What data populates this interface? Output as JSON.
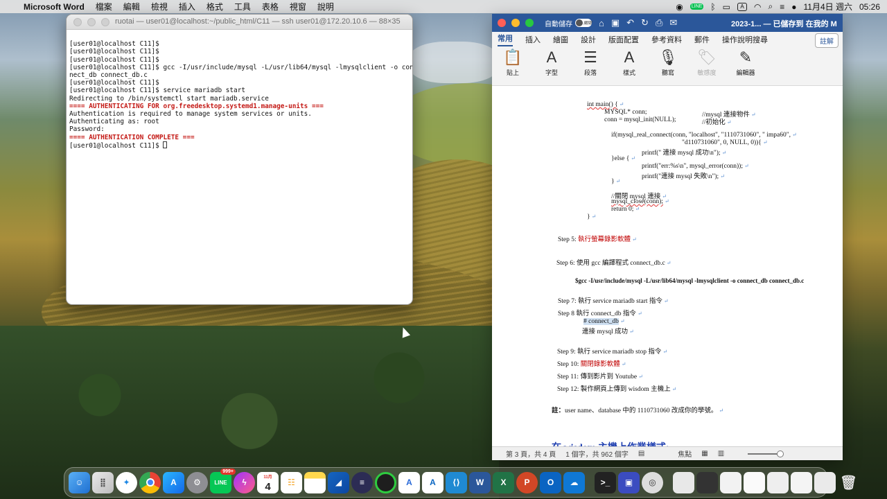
{
  "menubar": {
    "app_name": "Microsoft Word",
    "items": [
      "檔案",
      "編輯",
      "檢視",
      "插入",
      "格式",
      "工具",
      "表格",
      "視窗",
      "說明"
    ],
    "date": "11月4日 週六",
    "time": "05:26",
    "input_method": "A"
  },
  "terminal": {
    "title": "ruotai — user01@localhost:~/public_html/C11 — ssh user01@172.20.10.6 — 88×35",
    "lines": [
      {
        "text": "[user01@localhost C11]$",
        "style": "normal"
      },
      {
        "text": "[user01@localhost C11]$",
        "style": "normal"
      },
      {
        "text": "[user01@localhost C11]$",
        "style": "normal"
      },
      {
        "text": "[user01@localhost C11]$ gcc -I/usr/include/mysql -L/usr/lib64/mysql -lmysqlclient -o con",
        "style": "normal"
      },
      {
        "text": "nect_db connect_db.c",
        "style": "normal"
      },
      {
        "text": "[user01@localhost C11]$",
        "style": "normal"
      },
      {
        "text": "[user01@localhost C11]$ service mariadb start",
        "style": "normal"
      },
      {
        "text": "Redirecting to /bin/systemctl start mariadb.service",
        "style": "normal"
      },
      {
        "text": "==== AUTHENTICATING FOR org.freedesktop.systemd1.manage-units ===",
        "style": "red"
      },
      {
        "text": "Authentication is required to manage system services or units.",
        "style": "normal"
      },
      {
        "text": "Authenticating as: root",
        "style": "normal"
      },
      {
        "text": "Password:",
        "style": "normal"
      },
      {
        "text": "==== AUTHENTICATION COMPLETE ===",
        "style": "red"
      }
    ],
    "prompt": "[user01@localhost C11]$ "
  },
  "word": {
    "autosave_label": "自動儲存",
    "autosave_state": "關閉",
    "doc_title": "2023-1... — 已儲存到 在我的 M",
    "tabs": [
      "常用",
      "插入",
      "繪圖",
      "設計",
      "版面配置",
      "參考資料",
      "郵件",
      "操作說明搜尋"
    ],
    "active_tab": "常用",
    "comment_label": "註解",
    "ribbon": [
      {
        "label": "貼上",
        "icon": "paste-icon",
        "glyph": "📋"
      },
      {
        "label": "字型",
        "icon": "font-icon",
        "glyph": "A"
      },
      {
        "label": "段落",
        "icon": "paragraph-icon",
        "glyph": "☰"
      },
      {
        "label": "樣式",
        "icon": "styles-icon",
        "glyph": "A"
      },
      {
        "label": "聽寫",
        "icon": "microphone-icon",
        "glyph": "🎙"
      },
      {
        "label": "敏感度",
        "icon": "sensitivity-icon",
        "glyph": "🏷"
      },
      {
        "label": "編輯器",
        "icon": "editor-icon",
        "glyph": "✎"
      }
    ],
    "code": {
      "l1": "int main() {",
      "l2a": "MYSQL* conn;",
      "l2b": "//mysql 連接物件",
      "l3a": "conn = mysql_init(NULL);",
      "l3b": "//初始化",
      "l4": "if(mysql_real_connect(conn, \"localhost\", \"1110731060\", \" impa60\",",
      "l5": "\"d110731060\", 0, NULL, 0)){",
      "l6": "printf(\" 連接 mysql 成功\\n\");",
      "l7": "}else {",
      "l8": "printf(\"err:%s\\n\", mysql_error(conn));",
      "l9": "printf(\"連接 mysql 失敗\\n\");",
      "l10": "}",
      "l11": "//關閉 mysql 連接",
      "l12": "mysql_close(conn);",
      "l13": "return 0;",
      "l14": "}"
    },
    "steps": {
      "s5_label": "Step 5:",
      "s5_text": "執行螢幕錄影軟體",
      "s6_label": "Step 6:",
      "s6_text": "使用 gcc  編譯程式 connect_db.c",
      "cmd": "$gcc -I/usr/include/mysql -L/usr/lib64/mysql -lmysqlclient -o connect_db connect_db.c",
      "s7_label": "Step 7:",
      "s7_text": "執行 service mariadb start 指令",
      "s8_label": "Step 8",
      "s8_text": "執行 connect_db 指令",
      "s8_cmd": "# connect_db",
      "s8_out": "連接 mysql 成功",
      "s9_label": "Step 9:",
      "s9_text": "執行 service mariadb stop 指令",
      "s10_label": "Step 10:",
      "s10_text": "關閉錄影軟體",
      "s11_label": "Step 11:",
      "s11_text": "傳到影片到  Youtube",
      "s12_label": "Step 12:",
      "s12_text": "製作網頁上傳到  wisdom  主機上"
    },
    "note_label": "註：",
    "note_text": "user name、database  中的 1110731060  改成你的學號。",
    "heading": "在 wisdom  主機上作業樣式:",
    "status": {
      "page": "第 3 頁，共 4 頁",
      "words": "1 個字，共 962 個字",
      "focus": "焦點"
    }
  },
  "dock": {
    "line_badge": "999+",
    "calendar_month": "11月",
    "calendar_day": "4"
  }
}
